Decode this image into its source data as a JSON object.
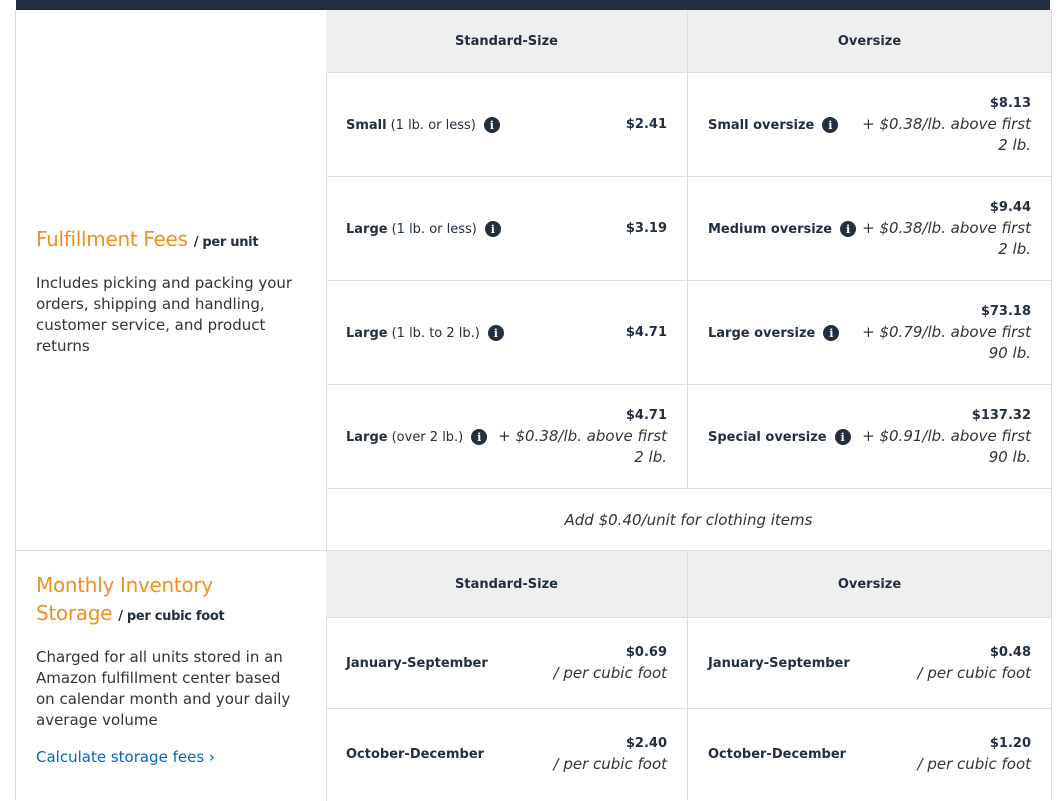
{
  "fulfillment": {
    "title": "Fulfillment Fees",
    "unit": "/ per unit",
    "description": "Includes picking and packing your orders, shipping and handling, customer service, and product returns",
    "header_standard": "Standard-Size",
    "header_oversize": "Oversize",
    "rows": [
      {
        "std_label": "Small",
        "std_sub": "(1 lb. or less)",
        "std_amt": "$2.41",
        "std_extra": "",
        "over_label": "Small oversize",
        "over_amt": "$8.13",
        "over_extra": "+ $0.38/lb. above first 2 lb."
      },
      {
        "std_label": "Large",
        "std_sub": "(1 lb. or less)",
        "std_amt": "$3.19",
        "std_extra": "",
        "over_label": "Medium oversize",
        "over_amt": "$9.44",
        "over_extra": "+ $0.38/lb. above first 2 lb."
      },
      {
        "std_label": "Large",
        "std_sub": "(1 lb. to 2 lb.)",
        "std_amt": "$4.71",
        "std_extra": "",
        "over_label": "Large oversize",
        "over_amt": "$73.18",
        "over_extra": "+ $0.79/lb. above first 90 lb."
      },
      {
        "std_label": "Large",
        "std_sub": "(over 2 lb.)",
        "std_amt": "$4.71",
        "std_extra": "+ $0.38/lb. above first 2 lb.",
        "over_label": "Special oversize",
        "over_amt": "$137.32",
        "over_extra": "+ $0.91/lb. above first 90 lb."
      }
    ],
    "clothing_note": "Add $0.40/unit for clothing items"
  },
  "storage": {
    "title_line1": "Monthly Inventory",
    "title_line2": "Storage",
    "unit": "/ per cubic foot",
    "description": "Charged for all units stored in an Amazon fulfillment center based on calendar month and your daily average volume",
    "link": "Calculate storage fees ›",
    "header_standard": "Standard-Size",
    "header_oversize": "Oversize",
    "rows": [
      {
        "std_label": "January-September",
        "std_amt": "$0.69",
        "std_extra": "/ per cubic foot",
        "over_label": "January-September",
        "over_amt": "$0.48",
        "over_extra": "/ per cubic foot"
      },
      {
        "std_label": "October-December",
        "std_amt": "$2.40",
        "std_extra": "/ per cubic foot",
        "over_label": "October-December",
        "over_amt": "$1.20",
        "over_extra": "/ per cubic foot"
      }
    ]
  },
  "icons": {
    "info": "info-icon",
    "chevron": "chevron-right-icon"
  },
  "colors": {
    "accent": "#f0901e",
    "dark": "#232f3e",
    "link": "#0066c0",
    "header_bg": "#efefef"
  }
}
